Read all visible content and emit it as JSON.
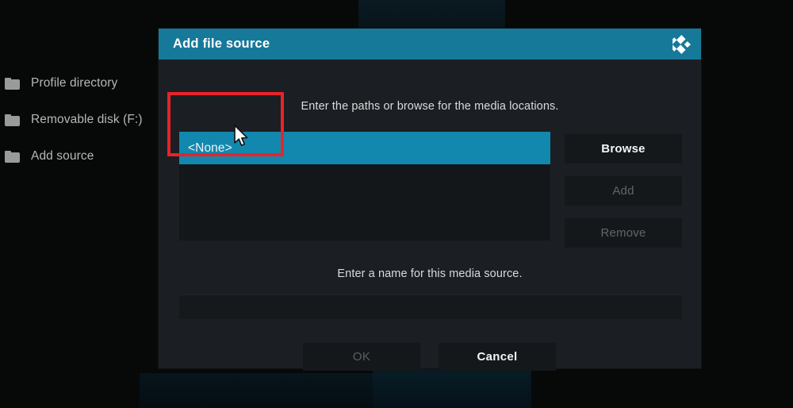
{
  "background": {
    "file_list": [
      {
        "icon": "folder-icon",
        "label": "Profile directory"
      },
      {
        "icon": "folder-icon",
        "label": "Removable disk (F:)"
      },
      {
        "icon": "folder-icon",
        "label": "Add source"
      }
    ]
  },
  "dialog": {
    "title": "Add file source",
    "logo_icon": "kodi-logo-icon",
    "paths_hint": "Enter the paths or browse for the media locations.",
    "paths_list": [
      {
        "label": "<None>",
        "selected": true
      }
    ],
    "side_buttons": [
      {
        "label": "Browse",
        "enabled": true
      },
      {
        "label": "Add",
        "enabled": false
      },
      {
        "label": "Remove",
        "enabled": false
      }
    ],
    "name_hint": "Enter a name for this media source.",
    "name_input": {
      "value": "",
      "placeholder": ""
    },
    "bottom_buttons": [
      {
        "label": "OK",
        "enabled": false
      },
      {
        "label": "Cancel",
        "enabled": true
      }
    ]
  },
  "annotation": {
    "color": "#e8232a",
    "target": "<None>"
  },
  "cursor": {
    "icon": "mouse-pointer-icon"
  },
  "colors": {
    "titlebar": "#17799a",
    "selection": "#1388ae",
    "dialog_body": "#1b1f23",
    "listbox": "#141719",
    "button": "#15181b",
    "text_enabled": "#f2f5f6",
    "text_disabled": "#5e6669",
    "annotation_red": "#e8232a"
  }
}
